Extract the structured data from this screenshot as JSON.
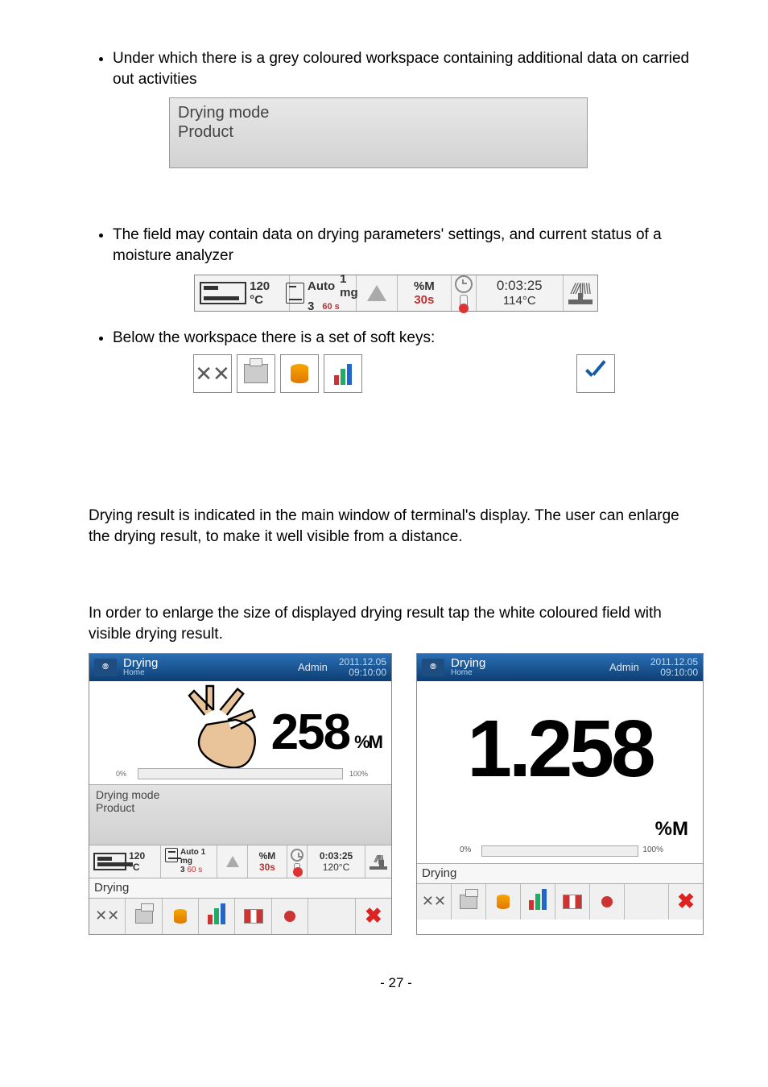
{
  "bullets": {
    "b1": "Under which there is a grey coloured workspace containing additional data on carried out activities",
    "b2": "The field may contain data on drying parameters' settings, and current status of a moisture analyzer",
    "b3": "Below the workspace there is a set of soft keys:"
  },
  "grey_field": {
    "line1": "Drying mode",
    "line2": "Product"
  },
  "status_bar": {
    "temp": "120 °C",
    "auto": "Auto",
    "mg": "1 mg",
    "three": "3",
    "sixtys": "60 s",
    "pctM": "%M",
    "thirtys": "30s",
    "time": "0:03:25",
    "temp2": "114°C"
  },
  "para1": "Drying result is indicated in the main window of terminal's display. The user can enlarge the drying result, to make it well visible from a distance.",
  "para2": "In order to enlarge the size of displayed drying result tap the white coloured field with visible drying result.",
  "screenshot": {
    "header_title": "Drying",
    "header_sub": "Home",
    "admin": "Admin",
    "date": "2011.12.05",
    "time": "09:10:00",
    "big_val": "258",
    "big_unit": "%M",
    "prog_left": "0%",
    "prog_right": "100%",
    "grey_line1": "Drying mode",
    "grey_line2": "Product",
    "st_temp": "120 °C",
    "st_auto": "Auto",
    "st_mg": "1 mg",
    "st_three": "3",
    "st_60s": "60 s",
    "st_pctM": "%M",
    "st_30s": "30s",
    "st_time": "0:03:25",
    "st_temp2": "120°C",
    "label": "Drying",
    "mega_val": "1.258",
    "mega_unit": "%M"
  },
  "page_number": "- 27 -"
}
